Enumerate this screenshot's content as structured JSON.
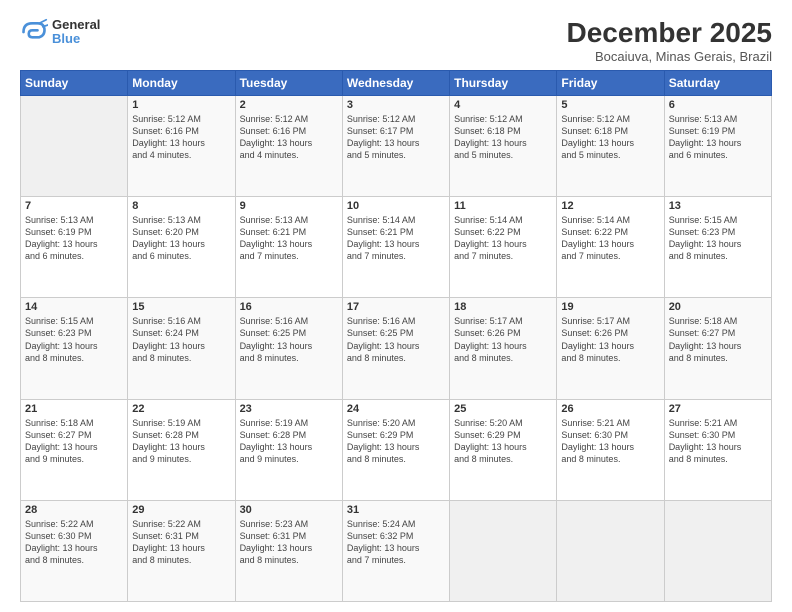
{
  "header": {
    "logo_line1": "General",
    "logo_line2": "Blue",
    "month": "December 2025",
    "location": "Bocaiuva, Minas Gerais, Brazil"
  },
  "days_of_week": [
    "Sunday",
    "Monday",
    "Tuesday",
    "Wednesday",
    "Thursday",
    "Friday",
    "Saturday"
  ],
  "weeks": [
    [
      {
        "day": "",
        "info": ""
      },
      {
        "day": "1",
        "info": "Sunrise: 5:12 AM\nSunset: 6:16 PM\nDaylight: 13 hours\nand 4 minutes."
      },
      {
        "day": "2",
        "info": "Sunrise: 5:12 AM\nSunset: 6:16 PM\nDaylight: 13 hours\nand 4 minutes."
      },
      {
        "day": "3",
        "info": "Sunrise: 5:12 AM\nSunset: 6:17 PM\nDaylight: 13 hours\nand 5 minutes."
      },
      {
        "day": "4",
        "info": "Sunrise: 5:12 AM\nSunset: 6:18 PM\nDaylight: 13 hours\nand 5 minutes."
      },
      {
        "day": "5",
        "info": "Sunrise: 5:12 AM\nSunset: 6:18 PM\nDaylight: 13 hours\nand 5 minutes."
      },
      {
        "day": "6",
        "info": "Sunrise: 5:13 AM\nSunset: 6:19 PM\nDaylight: 13 hours\nand 6 minutes."
      }
    ],
    [
      {
        "day": "7",
        "info": "Sunrise: 5:13 AM\nSunset: 6:19 PM\nDaylight: 13 hours\nand 6 minutes."
      },
      {
        "day": "8",
        "info": "Sunrise: 5:13 AM\nSunset: 6:20 PM\nDaylight: 13 hours\nand 6 minutes."
      },
      {
        "day": "9",
        "info": "Sunrise: 5:13 AM\nSunset: 6:21 PM\nDaylight: 13 hours\nand 7 minutes."
      },
      {
        "day": "10",
        "info": "Sunrise: 5:14 AM\nSunset: 6:21 PM\nDaylight: 13 hours\nand 7 minutes."
      },
      {
        "day": "11",
        "info": "Sunrise: 5:14 AM\nSunset: 6:22 PM\nDaylight: 13 hours\nand 7 minutes."
      },
      {
        "day": "12",
        "info": "Sunrise: 5:14 AM\nSunset: 6:22 PM\nDaylight: 13 hours\nand 7 minutes."
      },
      {
        "day": "13",
        "info": "Sunrise: 5:15 AM\nSunset: 6:23 PM\nDaylight: 13 hours\nand 8 minutes."
      }
    ],
    [
      {
        "day": "14",
        "info": "Sunrise: 5:15 AM\nSunset: 6:23 PM\nDaylight: 13 hours\nand 8 minutes."
      },
      {
        "day": "15",
        "info": "Sunrise: 5:16 AM\nSunset: 6:24 PM\nDaylight: 13 hours\nand 8 minutes."
      },
      {
        "day": "16",
        "info": "Sunrise: 5:16 AM\nSunset: 6:25 PM\nDaylight: 13 hours\nand 8 minutes."
      },
      {
        "day": "17",
        "info": "Sunrise: 5:16 AM\nSunset: 6:25 PM\nDaylight: 13 hours\nand 8 minutes."
      },
      {
        "day": "18",
        "info": "Sunrise: 5:17 AM\nSunset: 6:26 PM\nDaylight: 13 hours\nand 8 minutes."
      },
      {
        "day": "19",
        "info": "Sunrise: 5:17 AM\nSunset: 6:26 PM\nDaylight: 13 hours\nand 8 minutes."
      },
      {
        "day": "20",
        "info": "Sunrise: 5:18 AM\nSunset: 6:27 PM\nDaylight: 13 hours\nand 8 minutes."
      }
    ],
    [
      {
        "day": "21",
        "info": "Sunrise: 5:18 AM\nSunset: 6:27 PM\nDaylight: 13 hours\nand 9 minutes."
      },
      {
        "day": "22",
        "info": "Sunrise: 5:19 AM\nSunset: 6:28 PM\nDaylight: 13 hours\nand 9 minutes."
      },
      {
        "day": "23",
        "info": "Sunrise: 5:19 AM\nSunset: 6:28 PM\nDaylight: 13 hours\nand 9 minutes."
      },
      {
        "day": "24",
        "info": "Sunrise: 5:20 AM\nSunset: 6:29 PM\nDaylight: 13 hours\nand 8 minutes."
      },
      {
        "day": "25",
        "info": "Sunrise: 5:20 AM\nSunset: 6:29 PM\nDaylight: 13 hours\nand 8 minutes."
      },
      {
        "day": "26",
        "info": "Sunrise: 5:21 AM\nSunset: 6:30 PM\nDaylight: 13 hours\nand 8 minutes."
      },
      {
        "day": "27",
        "info": "Sunrise: 5:21 AM\nSunset: 6:30 PM\nDaylight: 13 hours\nand 8 minutes."
      }
    ],
    [
      {
        "day": "28",
        "info": "Sunrise: 5:22 AM\nSunset: 6:30 PM\nDaylight: 13 hours\nand 8 minutes."
      },
      {
        "day": "29",
        "info": "Sunrise: 5:22 AM\nSunset: 6:31 PM\nDaylight: 13 hours\nand 8 minutes."
      },
      {
        "day": "30",
        "info": "Sunrise: 5:23 AM\nSunset: 6:31 PM\nDaylight: 13 hours\nand 8 minutes."
      },
      {
        "day": "31",
        "info": "Sunrise: 5:24 AM\nSunset: 6:32 PM\nDaylight: 13 hours\nand 7 minutes."
      },
      {
        "day": "",
        "info": ""
      },
      {
        "day": "",
        "info": ""
      },
      {
        "day": "",
        "info": ""
      }
    ]
  ]
}
